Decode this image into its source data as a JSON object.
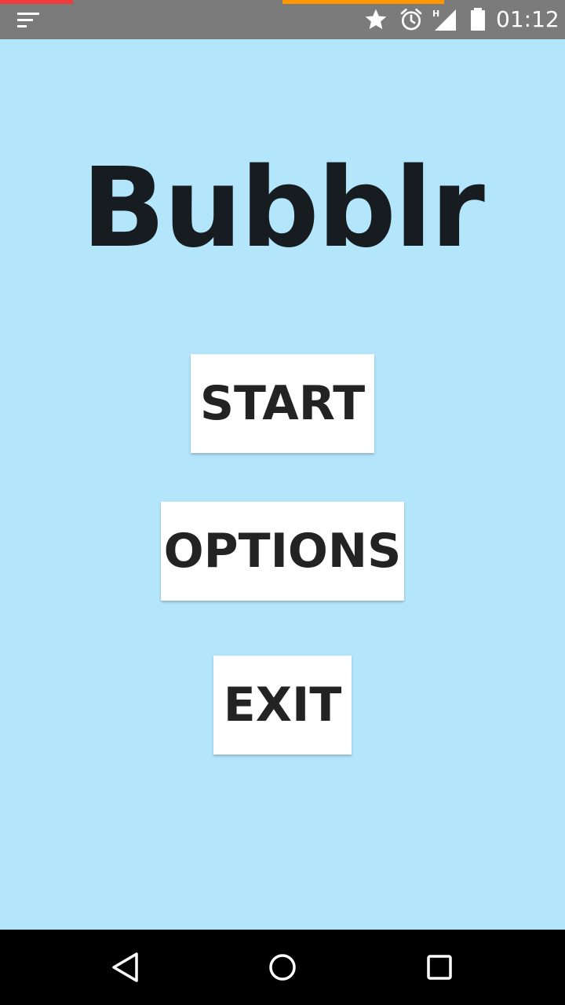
{
  "status_bar": {
    "time": "01:12",
    "network_type": "H",
    "icons": [
      "notification-icon",
      "star-icon",
      "alarm-icon",
      "signal-icon",
      "battery-icon"
    ],
    "colors": {
      "background": "#7b7b7b",
      "accent_left": "#ef3b3b",
      "accent_right": "#ff9800"
    }
  },
  "app": {
    "title": "Bubblr",
    "background": "#b3e5fb"
  },
  "menu": {
    "start_label": "START",
    "options_label": "OPTIONS",
    "exit_label": "EXIT"
  },
  "nav_bar": {
    "icons": [
      "back-icon",
      "home-icon",
      "recents-icon"
    ]
  }
}
